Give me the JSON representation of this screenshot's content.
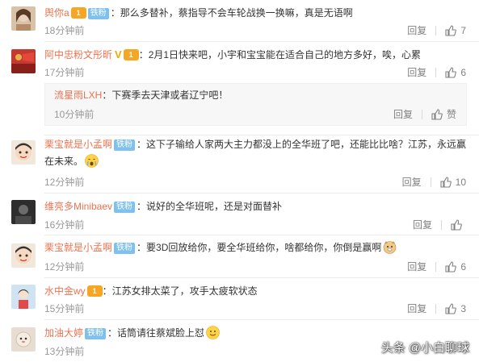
{
  "common": {
    "reply_label": "回复",
    "like_label": "赞",
    "fan_badge": "铁粉"
  },
  "comments": [
    {
      "user": "舆你a",
      "vip": "1",
      "badge": true,
      "text": "：那么多替补，蔡指导不会车轮战换一换嘛，真是无语啊",
      "time": "18分钟前",
      "likes": "7",
      "avatar_color": "#b58b6a"
    },
    {
      "user": "阿中忠粉文彤昕",
      "vmark": "V",
      "vip": "1",
      "badge": false,
      "text": "：2月1日快来吧，小宇和宝宝能在适合自己的地方多好，唉，心累",
      "time": "17分钟前",
      "likes": "6",
      "avatar_color": "#c43a30"
    },
    {
      "user": "流星雨LXH",
      "text": "：下赛季去天津或者辽宁吧！",
      "time": "10分钟前",
      "likes": "赞"
    },
    {
      "user": "栗宝就是小孟啊",
      "badge": true,
      "text": "：这下子输给人家两大主力都没上的全华班了吧，还能比比啥？江苏，永远赢在未来。",
      "time": "12分钟前",
      "likes": "10",
      "avatar_color": "#e8d6c8"
    },
    {
      "user": "维亮多Minibaev",
      "badge": true,
      "text": "：说好的全华班呢，还是对面替补",
      "time": "16分钟前",
      "likes": "",
      "avatar_color": "#3a3a3a"
    },
    {
      "user": "栗宝就是小孟啊",
      "badge": true,
      "text": "：要3D回放给你，要全华班给你，啥都给你，你倒是赢啊",
      "time": "12分钟前",
      "likes": "6",
      "avatar_color": "#e8d6c8"
    },
    {
      "user": "水中金wy",
      "vip": "1",
      "badge": false,
      "text": "：江苏女排太菜了，攻手太疲软状态",
      "time": "15分钟前",
      "likes": "3",
      "avatar_color": "#9fc3e0"
    },
    {
      "user": "加油大婷",
      "badge": true,
      "text": "：话筒请往蔡斌脸上怼",
      "time": "13分钟前",
      "likes": "",
      "avatar_color": "#d9c9b8"
    }
  ],
  "watermark": "头条 @小白聊球",
  "colors": {
    "username": "#eb7350",
    "badge": "#7ec0ee",
    "vip": "#f6a623"
  }
}
